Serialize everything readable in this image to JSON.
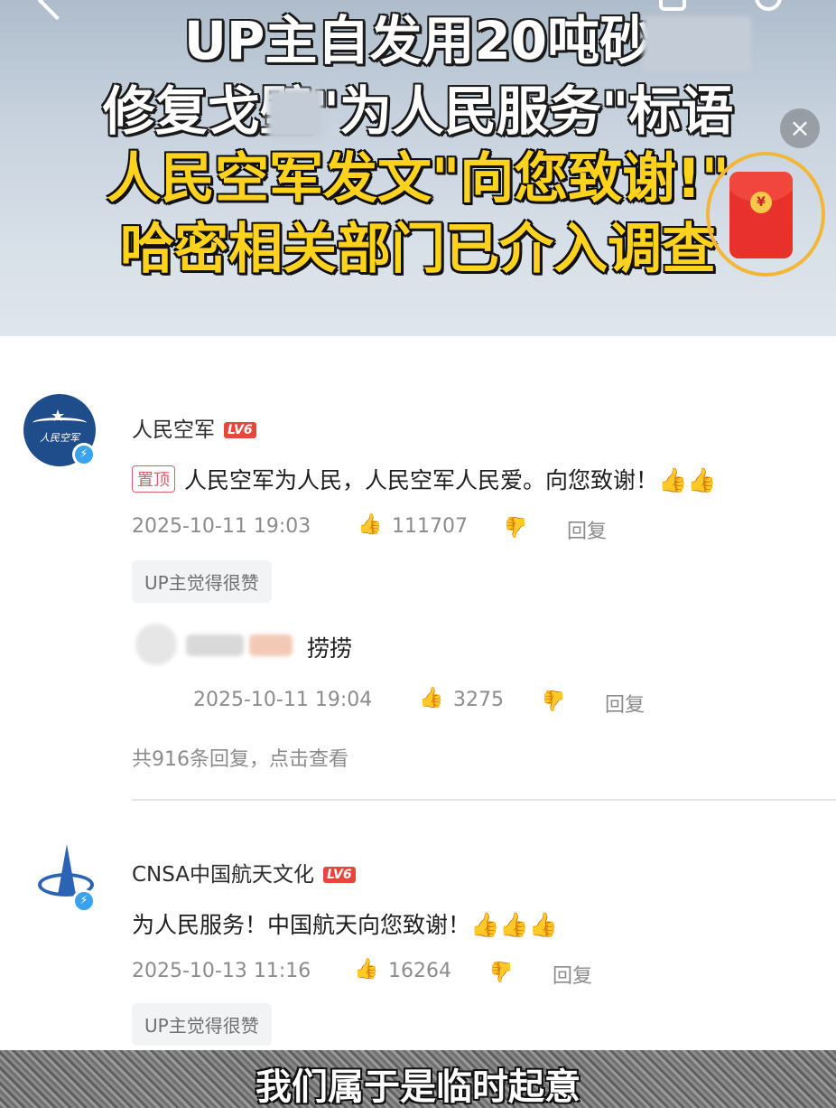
{
  "banner": {
    "line1": "UP主自发用20吨砂",
    "line2": "修复戈壁\"为人民服务\"标语",
    "line3": "人民空军发文\"向您致谢!\"",
    "line4": "哈密相关部门已介入调查",
    "close_label": "×",
    "redpacket_seal": "¥"
  },
  "comments": [
    {
      "avatar_text": "人民空军",
      "username": "人民空军",
      "level": "LV6",
      "pinned_label": "置顶",
      "text": "人民空军为人民，人民空军人民爱。向您致谢！",
      "emoji": "👍👍",
      "time": "2025-10-11 19:03",
      "likes": "111707",
      "reply_label": "回复",
      "tag": "UP主觉得很赞",
      "reply": {
        "text": "捞捞",
        "time": "2025-10-11 19:04",
        "likes": "3275",
        "reply_label": "回复"
      },
      "view_replies": "共916条回复，点击查看"
    },
    {
      "username": "CNSA中国航天文化",
      "level": "LV6",
      "text": "为人民服务！中国航天向您致谢！",
      "emoji": "👍👍👍",
      "time": "2025-10-13 11:16",
      "likes": "16264",
      "reply_label": "回复",
      "tag": "UP主觉得很赞"
    }
  ],
  "subtitle": "我们属于是临时起意",
  "icons": {
    "like": "👍",
    "dislike": "👍",
    "verified": "⚡"
  }
}
